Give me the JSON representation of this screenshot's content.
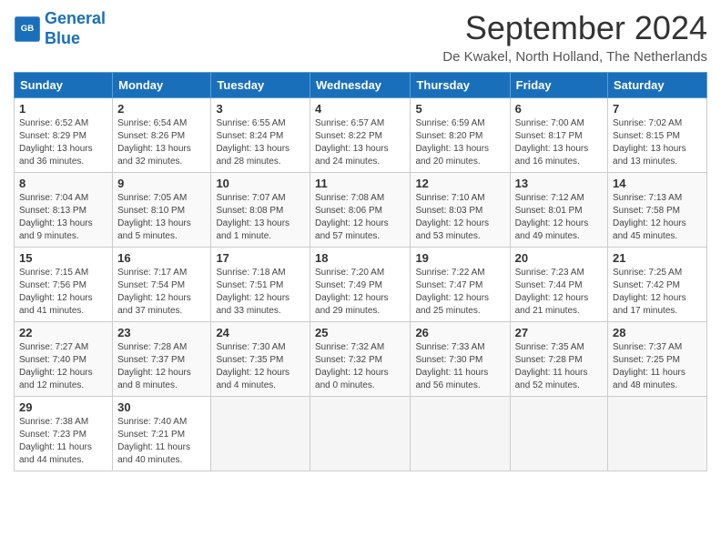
{
  "header": {
    "logo_line1": "General",
    "logo_line2": "Blue",
    "month_title": "September 2024",
    "location": "De Kwakel, North Holland, The Netherlands"
  },
  "days_of_week": [
    "Sunday",
    "Monday",
    "Tuesday",
    "Wednesday",
    "Thursday",
    "Friday",
    "Saturday"
  ],
  "weeks": [
    [
      {
        "day": "1",
        "info": "Sunrise: 6:52 AM\nSunset: 8:29 PM\nDaylight: 13 hours\nand 36 minutes."
      },
      {
        "day": "2",
        "info": "Sunrise: 6:54 AM\nSunset: 8:26 PM\nDaylight: 13 hours\nand 32 minutes."
      },
      {
        "day": "3",
        "info": "Sunrise: 6:55 AM\nSunset: 8:24 PM\nDaylight: 13 hours\nand 28 minutes."
      },
      {
        "day": "4",
        "info": "Sunrise: 6:57 AM\nSunset: 8:22 PM\nDaylight: 13 hours\nand 24 minutes."
      },
      {
        "day": "5",
        "info": "Sunrise: 6:59 AM\nSunset: 8:20 PM\nDaylight: 13 hours\nand 20 minutes."
      },
      {
        "day": "6",
        "info": "Sunrise: 7:00 AM\nSunset: 8:17 PM\nDaylight: 13 hours\nand 16 minutes."
      },
      {
        "day": "7",
        "info": "Sunrise: 7:02 AM\nSunset: 8:15 PM\nDaylight: 13 hours\nand 13 minutes."
      }
    ],
    [
      {
        "day": "8",
        "info": "Sunrise: 7:04 AM\nSunset: 8:13 PM\nDaylight: 13 hours\nand 9 minutes."
      },
      {
        "day": "9",
        "info": "Sunrise: 7:05 AM\nSunset: 8:10 PM\nDaylight: 13 hours\nand 5 minutes."
      },
      {
        "day": "10",
        "info": "Sunrise: 7:07 AM\nSunset: 8:08 PM\nDaylight: 13 hours\nand 1 minute."
      },
      {
        "day": "11",
        "info": "Sunrise: 7:08 AM\nSunset: 8:06 PM\nDaylight: 12 hours\nand 57 minutes."
      },
      {
        "day": "12",
        "info": "Sunrise: 7:10 AM\nSunset: 8:03 PM\nDaylight: 12 hours\nand 53 minutes."
      },
      {
        "day": "13",
        "info": "Sunrise: 7:12 AM\nSunset: 8:01 PM\nDaylight: 12 hours\nand 49 minutes."
      },
      {
        "day": "14",
        "info": "Sunrise: 7:13 AM\nSunset: 7:58 PM\nDaylight: 12 hours\nand 45 minutes."
      }
    ],
    [
      {
        "day": "15",
        "info": "Sunrise: 7:15 AM\nSunset: 7:56 PM\nDaylight: 12 hours\nand 41 minutes."
      },
      {
        "day": "16",
        "info": "Sunrise: 7:17 AM\nSunset: 7:54 PM\nDaylight: 12 hours\nand 37 minutes."
      },
      {
        "day": "17",
        "info": "Sunrise: 7:18 AM\nSunset: 7:51 PM\nDaylight: 12 hours\nand 33 minutes."
      },
      {
        "day": "18",
        "info": "Sunrise: 7:20 AM\nSunset: 7:49 PM\nDaylight: 12 hours\nand 29 minutes."
      },
      {
        "day": "19",
        "info": "Sunrise: 7:22 AM\nSunset: 7:47 PM\nDaylight: 12 hours\nand 25 minutes."
      },
      {
        "day": "20",
        "info": "Sunrise: 7:23 AM\nSunset: 7:44 PM\nDaylight: 12 hours\nand 21 minutes."
      },
      {
        "day": "21",
        "info": "Sunrise: 7:25 AM\nSunset: 7:42 PM\nDaylight: 12 hours\nand 17 minutes."
      }
    ],
    [
      {
        "day": "22",
        "info": "Sunrise: 7:27 AM\nSunset: 7:40 PM\nDaylight: 12 hours\nand 12 minutes."
      },
      {
        "day": "23",
        "info": "Sunrise: 7:28 AM\nSunset: 7:37 PM\nDaylight: 12 hours\nand 8 minutes."
      },
      {
        "day": "24",
        "info": "Sunrise: 7:30 AM\nSunset: 7:35 PM\nDaylight: 12 hours\nand 4 minutes."
      },
      {
        "day": "25",
        "info": "Sunrise: 7:32 AM\nSunset: 7:32 PM\nDaylight: 12 hours\nand 0 minutes."
      },
      {
        "day": "26",
        "info": "Sunrise: 7:33 AM\nSunset: 7:30 PM\nDaylight: 11 hours\nand 56 minutes."
      },
      {
        "day": "27",
        "info": "Sunrise: 7:35 AM\nSunset: 7:28 PM\nDaylight: 11 hours\nand 52 minutes."
      },
      {
        "day": "28",
        "info": "Sunrise: 7:37 AM\nSunset: 7:25 PM\nDaylight: 11 hours\nand 48 minutes."
      }
    ],
    [
      {
        "day": "29",
        "info": "Sunrise: 7:38 AM\nSunset: 7:23 PM\nDaylight: 11 hours\nand 44 minutes."
      },
      {
        "day": "30",
        "info": "Sunrise: 7:40 AM\nSunset: 7:21 PM\nDaylight: 11 hours\nand 40 minutes."
      },
      {
        "day": "",
        "info": ""
      },
      {
        "day": "",
        "info": ""
      },
      {
        "day": "",
        "info": ""
      },
      {
        "day": "",
        "info": ""
      },
      {
        "day": "",
        "info": ""
      }
    ]
  ]
}
